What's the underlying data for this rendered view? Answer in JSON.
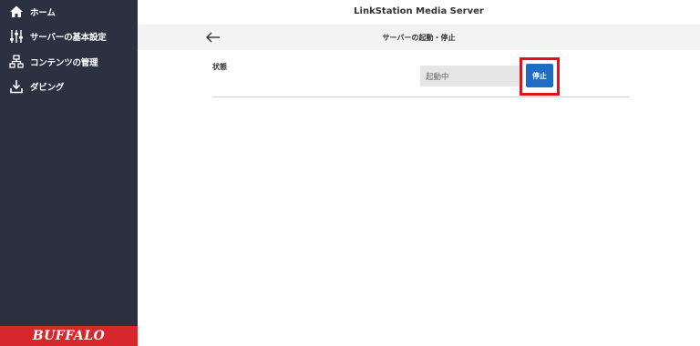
{
  "sidebar": {
    "items": [
      {
        "label": "ホーム",
        "icon": "home-icon"
      },
      {
        "label": "サーバーの基本設定",
        "icon": "sliders-icon"
      },
      {
        "label": "コンテンツの管理",
        "icon": "content-tree-icon"
      },
      {
        "label": "ダビング",
        "icon": "download-icon"
      }
    ],
    "brand": "BUFFALO"
  },
  "header": {
    "title": "LinkStation Media Server",
    "page_title": "サーバーの起動・停止"
  },
  "status": {
    "label": "状態",
    "value": "起動中",
    "stop_label": "停止"
  },
  "colors": {
    "sidebar_bg": "#2b3140",
    "brand_red": "#d7262c",
    "button_blue": "#1f6cc7",
    "highlight_red": "#e0131a"
  }
}
